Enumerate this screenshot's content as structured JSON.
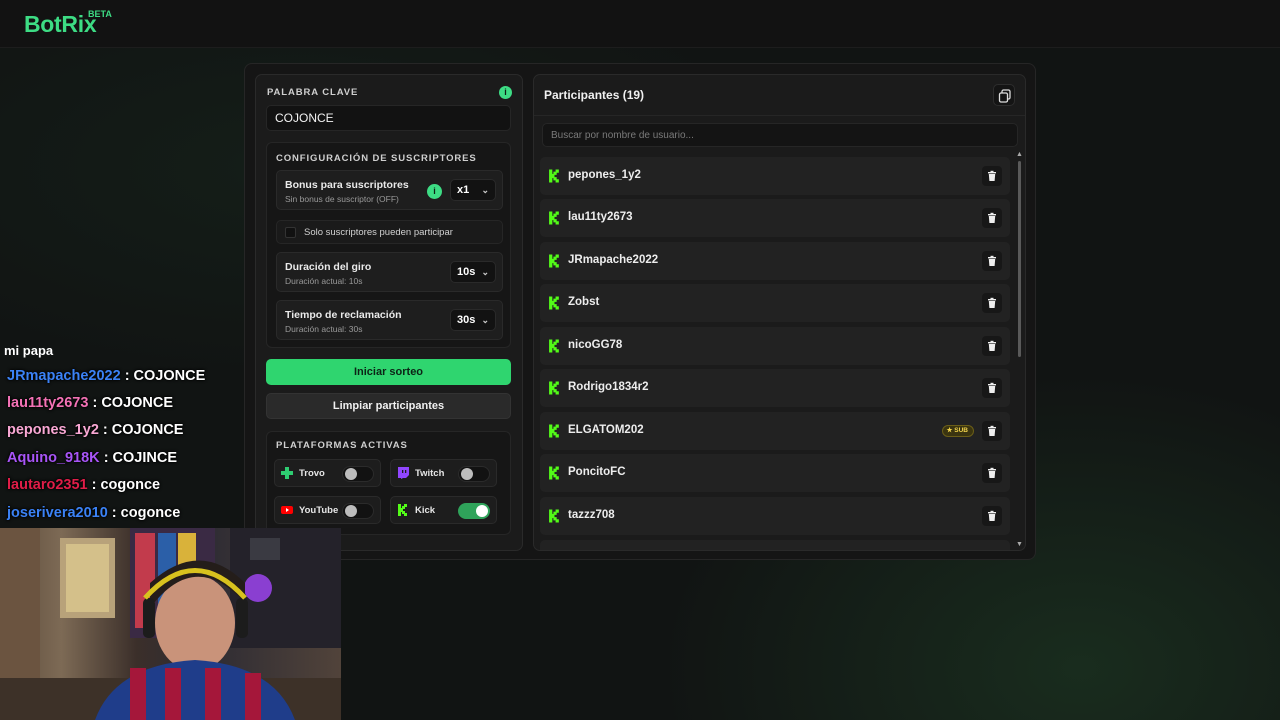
{
  "app": {
    "logo": "BotRix",
    "badge": "BETA"
  },
  "keyword": {
    "label": "PALABRA CLAVE",
    "value": "COJONCE",
    "info_icon": "info-icon"
  },
  "subscribers": {
    "section_label": "CONFIGURACIÓN DE SUSCRIPTORES",
    "bonus_title": "Bonus para suscriptores",
    "bonus_sub": "Sin bonus de suscriptor (OFF)",
    "bonus_value": "x1",
    "only_subs_label": "Solo suscriptores pueden participar",
    "spin_title": "Duración del giro",
    "spin_sub": "Duración actual: 10s",
    "spin_value": "10s",
    "claim_title": "Tiempo de reclamación",
    "claim_sub": "Duración actual: 30s",
    "claim_value": "30s"
  },
  "actions": {
    "start_label": "Iniciar sorteo",
    "clear_label": "Limpiar participantes"
  },
  "platforms": {
    "section_label": "PLATAFORMAS ACTIVAS",
    "items": [
      {
        "name": "Trovo",
        "enabled": false,
        "color": "#2ecc71"
      },
      {
        "name": "Twitch",
        "enabled": false,
        "color": "#9146ff"
      },
      {
        "name": "YouTube",
        "enabled": false,
        "color": "#ff0000"
      },
      {
        "name": "Kick",
        "enabled": true,
        "color": "#53fc18"
      }
    ]
  },
  "participants": {
    "title": "Participantes (19)",
    "search_placeholder": "Buscar por nombre de usuario...",
    "sub_badge": "SUB",
    "users": [
      {
        "name": "pepones_1y2",
        "sub": false
      },
      {
        "name": "lau11ty2673",
        "sub": false
      },
      {
        "name": "JRmapache2022",
        "sub": false
      },
      {
        "name": "Zobst",
        "sub": false
      },
      {
        "name": "nicoGG78",
        "sub": false
      },
      {
        "name": "Rodrigo1834r2",
        "sub": false
      },
      {
        "name": "ELGATOM202",
        "sub": true
      },
      {
        "name": "PoncitoFC",
        "sub": false
      },
      {
        "name": "tazzz708",
        "sub": false
      }
    ]
  },
  "chat": {
    "partial": "mi papa",
    "lines": [
      {
        "user": "JRmapache2022",
        "message": " : COJONCE",
        "color": "#3b82f6"
      },
      {
        "user": "lau11ty2673",
        "message": " : COJONCE",
        "color": "#f472b6"
      },
      {
        "user": "pepones_1y2",
        "message": " : COJONCE",
        "color": "#f9a8d4"
      },
      {
        "user": "Aquino_918K",
        "message": " : COJINCE",
        "color": "#a855f7"
      },
      {
        "user": "lautaro2351",
        "message": " : cogonce",
        "color": "#e11d48"
      },
      {
        "user": "joserivera2010",
        "message": " : cogonce",
        "color": "#3b82f6"
      }
    ]
  },
  "colors": {
    "accent": "#3ddc84",
    "kick": "#53fc18",
    "button_primary": "#2fd56f"
  }
}
